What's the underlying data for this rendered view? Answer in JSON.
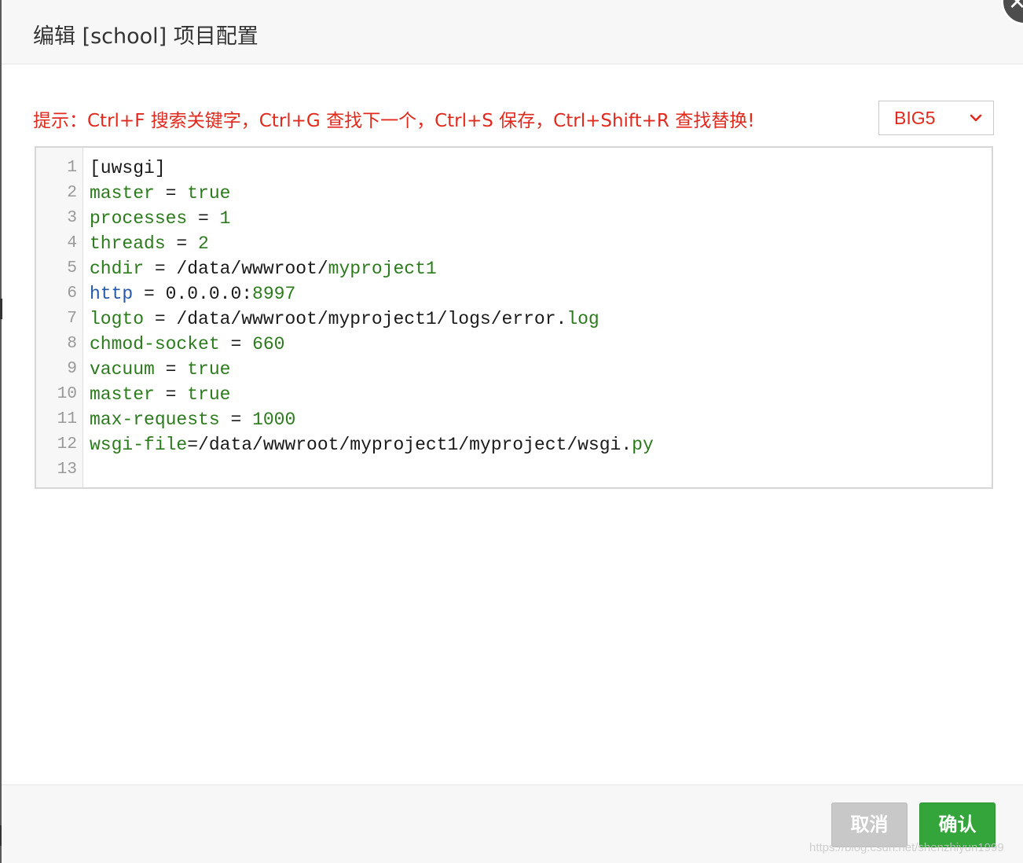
{
  "dialog": {
    "title": "编辑 [school] 项目配置",
    "close_icon": "close-icon",
    "hint": "提示：Ctrl+F 搜索关键字，Ctrl+G 查找下一个，Ctrl+S 保存，Ctrl+Shift+R 查找替换!",
    "encoding": {
      "selected": "BIG5",
      "icon": "chevron-down-icon"
    }
  },
  "editor": {
    "line_numbers": [
      "1",
      "2",
      "3",
      "4",
      "5",
      "6",
      "7",
      "8",
      "9",
      "10",
      "11",
      "12",
      "13"
    ],
    "lines": [
      [
        {
          "t": "[uwsgi]",
          "c": "plain"
        }
      ],
      [
        {
          "t": "master",
          "c": "key"
        },
        {
          "t": " = ",
          "c": "plain"
        },
        {
          "t": "true",
          "c": "val"
        }
      ],
      [
        {
          "t": "processes",
          "c": "key"
        },
        {
          "t": " = ",
          "c": "plain"
        },
        {
          "t": "1",
          "c": "num"
        }
      ],
      [
        {
          "t": "threads",
          "c": "key"
        },
        {
          "t": " = ",
          "c": "plain"
        },
        {
          "t": "2",
          "c": "num"
        }
      ],
      [
        {
          "t": "chdir",
          "c": "key"
        },
        {
          "t": " = /data/wwwroot/",
          "c": "plain"
        },
        {
          "t": "myproject1",
          "c": "val"
        }
      ],
      [
        {
          "t": "http",
          "c": "keyword"
        },
        {
          "t": " = 0.0.0.0:",
          "c": "plain"
        },
        {
          "t": "8997",
          "c": "num"
        }
      ],
      [
        {
          "t": "logto",
          "c": "key"
        },
        {
          "t": " = /data/wwwroot/myproject1/logs/error.",
          "c": "plain"
        },
        {
          "t": "log",
          "c": "val"
        }
      ],
      [
        {
          "t": "chmod-socket",
          "c": "key"
        },
        {
          "t": " = ",
          "c": "plain"
        },
        {
          "t": "660",
          "c": "num"
        }
      ],
      [
        {
          "t": "vacuum",
          "c": "key"
        },
        {
          "t": " = ",
          "c": "plain"
        },
        {
          "t": "true",
          "c": "val"
        }
      ],
      [
        {
          "t": "master",
          "c": "key"
        },
        {
          "t": " = ",
          "c": "plain"
        },
        {
          "t": "true",
          "c": "val"
        }
      ],
      [
        {
          "t": "max-requests",
          "c": "key"
        },
        {
          "t": " = ",
          "c": "plain"
        },
        {
          "t": "1000",
          "c": "num"
        }
      ],
      [
        {
          "t": "wsgi-file",
          "c": "key"
        },
        {
          "t": "=/data/wwwroot/myproject1/myproject/wsgi.",
          "c": "plain"
        },
        {
          "t": "py",
          "c": "val"
        }
      ],
      []
    ]
  },
  "footer": {
    "cancel_label": "取消",
    "confirm_label": "确认"
  },
  "watermark": "https://blog.csdn.net/shenzhiyun1999",
  "colors": {
    "hint": "#e12a1d",
    "confirm": "#33a53b",
    "cancel": "#c8c8c8",
    "syntax_green": "#2b7b1c",
    "syntax_blue": "#2359a8"
  }
}
